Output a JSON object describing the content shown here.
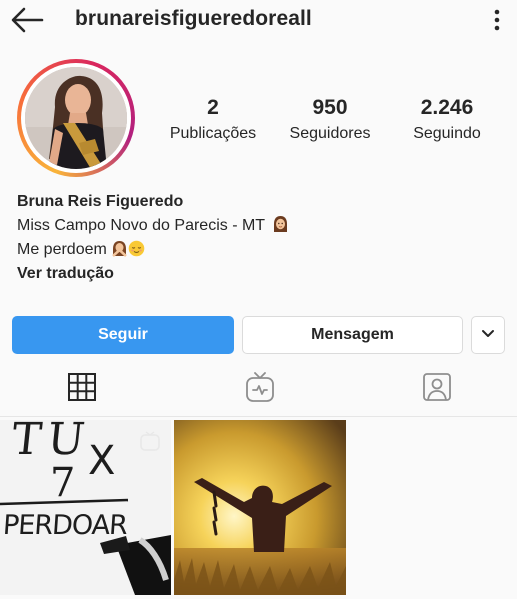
{
  "header": {
    "username": "brunareisfigueredoreall",
    "back_icon": "arrow-left-icon",
    "more_icon": "more-vertical-icon"
  },
  "profile": {
    "avatar": "profile-photo",
    "stats": [
      {
        "value": "2",
        "label": "Publicações"
      },
      {
        "value": "950",
        "label": "Seguidores"
      },
      {
        "value": "2.246",
        "label": "Seguindo"
      }
    ],
    "bio": {
      "name": "Bruna Reis Figueredo",
      "line1": "Miss Campo Novo do Parecis - MT",
      "line2": "Me perdoem",
      "translate": "Ver tradução"
    }
  },
  "actions": {
    "follow": "Seguir",
    "message": "Mensagem",
    "dropdown_icon": "chevron-down-icon"
  },
  "tabs": [
    {
      "icon": "grid-icon",
      "active": true
    },
    {
      "icon": "igtv-icon",
      "active": false
    },
    {
      "icon": "tagged-icon",
      "active": false
    }
  ],
  "posts": [
    {
      "type": "igtv",
      "handwriting": {
        "line1": "TU",
        "line2": "X",
        "line3": "7",
        "line4": "PERDOAR"
      }
    },
    {
      "type": "photo",
      "description": "person with raised arms and broken chain at sunset"
    }
  ],
  "colors": {
    "accent": "#3897f0",
    "text": "#262626",
    "border": "#dbdbdb"
  }
}
